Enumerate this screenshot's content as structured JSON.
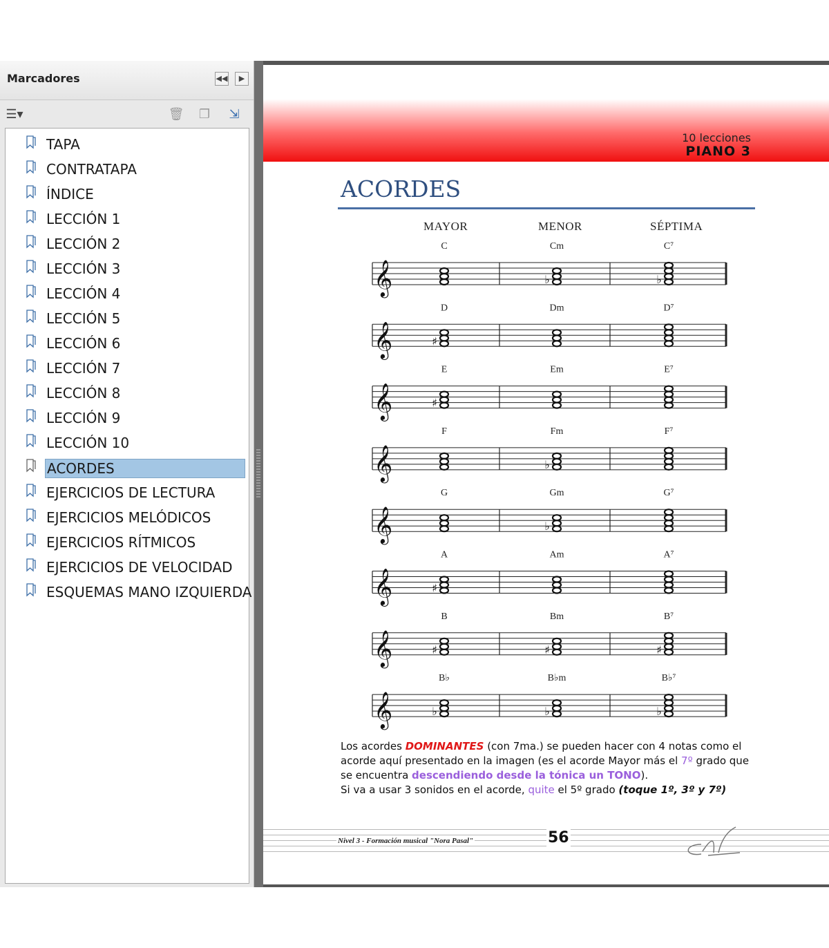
{
  "panel": {
    "title": "Marcadores",
    "icons": [
      "collapse-left-icon",
      "expand-right-icon",
      "options-menu-icon",
      "delete-icon",
      "new-bookmark-icon",
      "expand-bookmark-icon"
    ],
    "bookmarks": [
      {
        "label": "TAPA",
        "selected": false
      },
      {
        "label": "CONTRATAPA",
        "selected": false
      },
      {
        "label": "ÍNDICE",
        "selected": false
      },
      {
        "label": "LECCIÓN 1",
        "selected": false
      },
      {
        "label": "LECCIÓN 2",
        "selected": false
      },
      {
        "label": "LECCIÓN 3",
        "selected": false
      },
      {
        "label": "LECCIÓN 4",
        "selected": false
      },
      {
        "label": "LECCIÓN 5",
        "selected": false
      },
      {
        "label": "LECCIÓN 6",
        "selected": false
      },
      {
        "label": "LECCIÓN 7",
        "selected": false
      },
      {
        "label": "LECCIÓN 8",
        "selected": false
      },
      {
        "label": "LECCIÓN 9",
        "selected": false
      },
      {
        "label": "LECCIÓN 10",
        "selected": false
      },
      {
        "label": "ACORDES",
        "selected": true
      },
      {
        "label": "EJERCICIOS DE LECTURA",
        "selected": false
      },
      {
        "label": "EJERCICIOS MELÓDICOS",
        "selected": false
      },
      {
        "label": "EJERCICIOS RÍTMICOS",
        "selected": false
      },
      {
        "label": "EJERCICIOS DE VELOCIDAD",
        "selected": false
      },
      {
        "label": "ESQUEMAS MANO IZQUIERDA",
        "selected": false
      }
    ]
  },
  "page": {
    "header_line1": "10 lecciones",
    "header_line2": "PIANO 3",
    "title": "ACORDES",
    "columns": [
      "MAYOR",
      "MENOR",
      "SÉPTIMA"
    ],
    "chord_rows": [
      [
        "C",
        "Cm",
        "C⁷"
      ],
      [
        "D",
        "Dm",
        "D⁷"
      ],
      [
        "E",
        "Em",
        "E⁷"
      ],
      [
        "F",
        "Fm",
        "F⁷"
      ],
      [
        "G",
        "Gm",
        "G⁷"
      ],
      [
        "A",
        "Am",
        "A⁷"
      ],
      [
        "B",
        "Bm",
        "B⁷"
      ],
      [
        "B♭",
        "B♭m",
        "B♭⁷"
      ]
    ],
    "accidentals": [
      [
        "",
        "♭",
        "♭"
      ],
      [
        "♯",
        "",
        ""
      ],
      [
        "♯",
        "",
        ""
      ],
      [
        "",
        "♭",
        ""
      ],
      [
        "",
        "♭",
        ""
      ],
      [
        "♯",
        "",
        ""
      ],
      [
        "♯",
        "♯",
        "♯"
      ],
      [
        "♭",
        "♭",
        "♭"
      ]
    ],
    "notes": {
      "p1": "Los acordes ",
      "dominantes": "DOMINANTES",
      "p2": " (con 7ma.) se pueden hacer con 4 notas como el acorde aquí presentado en la imagen (es el acorde Mayor más el ",
      "seventh": "7º",
      "p3": " grado que se encuentra ",
      "descending": "descendiendo desde la tónica un TONO",
      "p4": ").",
      "p5": "Si va a usar 3 sonidos en el acorde, ",
      "quite": "quite",
      "p6": " el 5º grado ",
      "toque": "(toque 1º, 3º y 7º)"
    },
    "footer_left": "Nivel 3 - Formación musical \"Nora Pasal\"",
    "page_number": "56"
  }
}
